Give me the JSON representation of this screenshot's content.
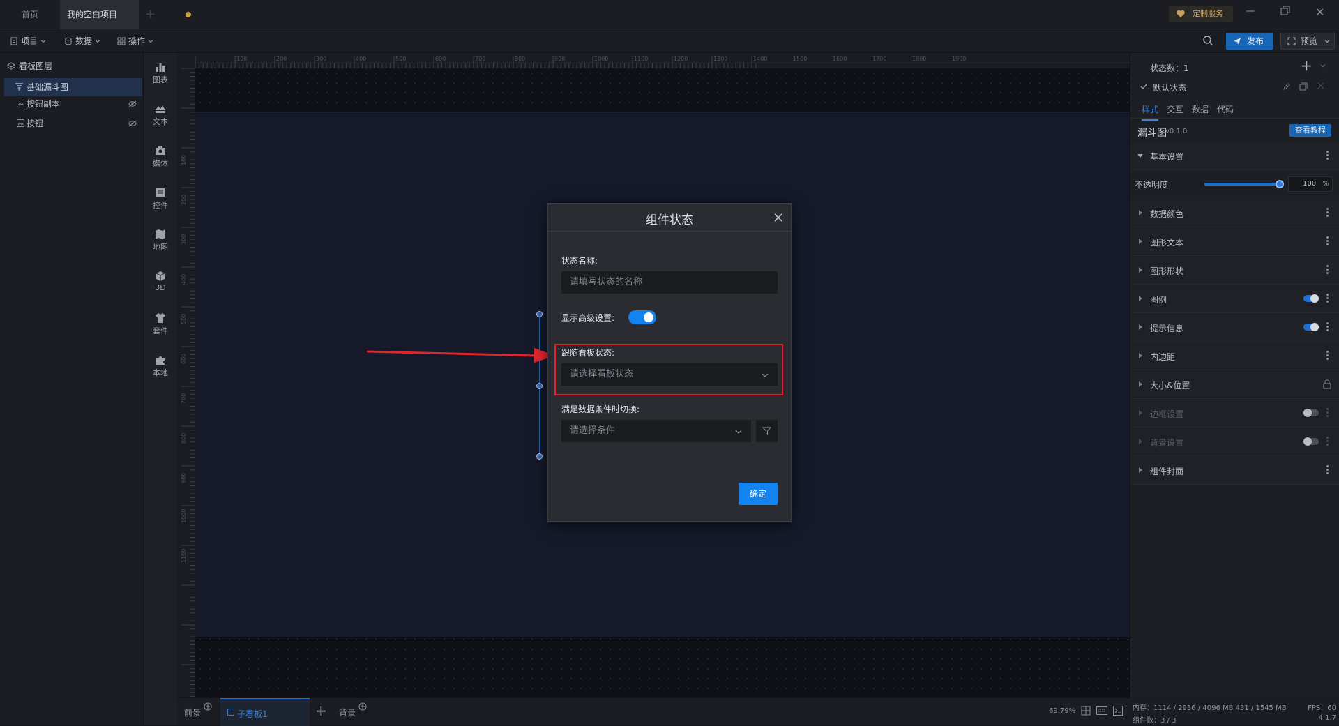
{
  "titlebar": {
    "tabs": [
      {
        "label": "首页"
      },
      {
        "label": "我的空白项目"
      }
    ],
    "add_tab": "+",
    "custom_service": "定制服务"
  },
  "toolbar": {
    "menus": [
      {
        "label": "项目"
      },
      {
        "label": "数据"
      },
      {
        "label": "操作"
      }
    ],
    "publish": "发布",
    "preview": "预览"
  },
  "layers": {
    "header": "看板图层",
    "items": [
      {
        "label": "基础漏斗图"
      },
      {
        "label": "按钮副本"
      },
      {
        "label": "按钮"
      }
    ]
  },
  "components": [
    {
      "label": "图表",
      "icon": "chart-icon"
    },
    {
      "label": "文本",
      "icon": "text-icon"
    },
    {
      "label": "媒体",
      "icon": "media-icon"
    },
    {
      "label": "控件",
      "icon": "control-icon"
    },
    {
      "label": "地图",
      "icon": "map-icon"
    },
    {
      "label": "3D",
      "icon": "cube-icon"
    },
    {
      "label": "套件",
      "icon": "kit-icon"
    },
    {
      "label": "本地",
      "icon": "puzzle-icon"
    }
  ],
  "ruler": {
    "top_ticks": [
      "100",
      "200",
      "300",
      "400",
      "500",
      "600",
      "700",
      "800",
      "900",
      "1000",
      "1100",
      "1200",
      "1300",
      "1400",
      "1500",
      "1600",
      "1700",
      "1800",
      "1900"
    ],
    "left_ticks": [
      "100",
      "200",
      "300",
      "400",
      "500",
      "600",
      "700",
      "800",
      "900",
      "1000",
      "1100"
    ]
  },
  "bottombar": {
    "foreground": "前景",
    "sub_board": "子看板1",
    "background": "背景",
    "zoom": "69.79%"
  },
  "right_panel": {
    "state_count": "状态数：1",
    "default_state": "默认状态",
    "tabs": [
      {
        "label": "样式"
      },
      {
        "label": "交互"
      },
      {
        "label": "数据"
      },
      {
        "label": "代码"
      }
    ],
    "component_name": "漏斗图",
    "version": "v0.1.0",
    "tutorial": "查看教程",
    "basic_settings": "基本设置",
    "opacity_label": "不透明度",
    "opacity_value": "100",
    "opacity_unit": "%",
    "opacity_fraction": 1.0,
    "sections": [
      {
        "label": "数据颜色"
      },
      {
        "label": "图形文本"
      },
      {
        "label": "图形形状"
      },
      {
        "label": "图例"
      },
      {
        "label": "提示信息"
      },
      {
        "label": "内边距"
      },
      {
        "label": "大小&位置"
      },
      {
        "label": "边框设置"
      },
      {
        "label": "背景设置"
      },
      {
        "label": "组件封面"
      }
    ]
  },
  "statusbar": {
    "memory": "内存：1114 / 2936 / 4096 MB  431 / 1545 MB",
    "fps": "FPS：60",
    "component_count": "组件数：3 / 3",
    "version": "4.1.7"
  },
  "dialog": {
    "title": "组件状态",
    "state_name_label": "状态名称:",
    "state_name_placeholder": "请填写状态的名称",
    "advanced_label": "显示高级设置:",
    "advanced_on": true,
    "follow_label": "跟随看板状态:",
    "follow_placeholder": "请选择看板状态",
    "condition_label": "满足数据条件时切换:",
    "condition_placeholder": "请选择条件",
    "confirm": "确定"
  },
  "colors": {
    "accent": "#1383f0",
    "highlight": "#e1262c",
    "panel": "#1d1f24"
  }
}
